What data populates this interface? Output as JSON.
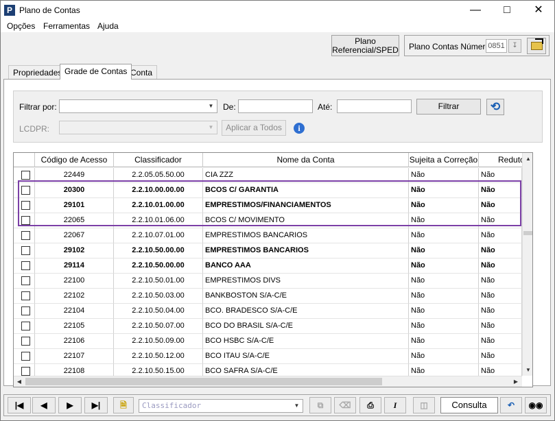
{
  "window": {
    "title": "Plano de Contas",
    "app_icon": "P",
    "minimize_icon": "minimize-icon",
    "maximize_icon": "maximize-icon",
    "close_icon": "close-icon"
  },
  "menu": [
    "Opções",
    "Ferramentas",
    "Ajuda"
  ],
  "top_buttons": {
    "plano_line1": "Plano",
    "plano_line2": "Referencial/SPED",
    "pcn_label": "Plano Contas Número",
    "pcn_value": "0851"
  },
  "tabs": [
    "Propriedades",
    "Grade de Contas",
    "Conta"
  ],
  "active_tab": "Grade de Contas",
  "filter": {
    "filtrar_por_label": "Filtrar por:",
    "filtrar_por_value": "",
    "de_label": "De:",
    "de_value": "",
    "ate_label": "Até:",
    "ate_value": "",
    "filtrar_button": "Filtrar",
    "lcdpr_label": "LCDPR:",
    "lcdpr_value": "",
    "aplicar_button": "Aplicar a Todos",
    "info_icon": "i"
  },
  "grid": {
    "columns": [
      "Código de Acesso",
      "Classificador",
      "Nome da Conta",
      "Sujeita a Correção",
      "Redutora"
    ],
    "header_visible": [
      "Código de Acesso",
      "Classificador",
      "Nome da Conta",
      "Sujeita a Correção",
      "Reduto"
    ],
    "rows": [
      {
        "checked": false,
        "bold": false,
        "codigo": "22449",
        "classificador": "2.2.05.05.50.00",
        "nome": "CIA ZZZ",
        "correcao": "Não",
        "redutora": "Não"
      },
      {
        "checked": false,
        "bold": true,
        "codigo": "20300",
        "classificador": "2.2.10.00.00.00",
        "nome": "BCOS C/ GARANTIA",
        "correcao": "Não",
        "redutora": "Não"
      },
      {
        "checked": false,
        "bold": true,
        "codigo": "29101",
        "classificador": "2.2.10.01.00.00",
        "nome": "EMPRESTIMOS/FINANCIAMENTOS",
        "correcao": "Não",
        "redutora": "Não"
      },
      {
        "checked": false,
        "bold": false,
        "codigo": "22065",
        "classificador": "2.2.10.01.06.00",
        "nome": "BCOS C/ MOVIMENTO",
        "correcao": "Não",
        "redutora": "Não"
      },
      {
        "checked": false,
        "bold": false,
        "codigo": "22067",
        "classificador": "2.2.10.07.01.00",
        "nome": "EMPRESTIMOS BANCARIOS",
        "correcao": "Não",
        "redutora": "Não"
      },
      {
        "checked": false,
        "bold": true,
        "codigo": "29102",
        "classificador": "2.2.10.50.00.00",
        "nome": "EMPRESTIMOS BANCARIOS",
        "correcao": "Não",
        "redutora": "Não"
      },
      {
        "checked": false,
        "bold": true,
        "codigo": "29114",
        "classificador": "2.2.10.50.00.00",
        "nome": "BANCO AAA",
        "correcao": "Não",
        "redutora": "Não"
      },
      {
        "checked": false,
        "bold": false,
        "codigo": "22100",
        "classificador": "2.2.10.50.01.00",
        "nome": "EMPRESTIMOS DIVS",
        "correcao": "Não",
        "redutora": "Não"
      },
      {
        "checked": false,
        "bold": false,
        "codigo": "22102",
        "classificador": "2.2.10.50.03.00",
        "nome": "BANKBOSTON S/A-C/E",
        "correcao": "Não",
        "redutora": "Não"
      },
      {
        "checked": false,
        "bold": false,
        "codigo": "22104",
        "classificador": "2.2.10.50.04.00",
        "nome": "BCO. BRADESCO S/A-C/E",
        "correcao": "Não",
        "redutora": "Não"
      },
      {
        "checked": false,
        "bold": false,
        "codigo": "22105",
        "classificador": "2.2.10.50.07.00",
        "nome": "BCO DO BRASIL S/A-C/E",
        "correcao": "Não",
        "redutora": "Não"
      },
      {
        "checked": false,
        "bold": false,
        "codigo": "22106",
        "classificador": "2.2.10.50.09.00",
        "nome": "BCO HSBC S/A-C/E",
        "correcao": "Não",
        "redutora": "Não"
      },
      {
        "checked": false,
        "bold": false,
        "codigo": "22107",
        "classificador": "2.2.10.50.12.00",
        "nome": "BCO ITAU S/A-C/E",
        "correcao": "Não",
        "redutora": "Não"
      },
      {
        "checked": false,
        "bold": false,
        "codigo": "22108",
        "classificador": "2.2.10.50.15.00",
        "nome": "BCO SAFRA S/A-C/E",
        "correcao": "Não",
        "redutora": "Não"
      }
    ],
    "highlighted_rows": [
      "20300",
      "29101",
      "22065"
    ]
  },
  "toolbar": {
    "first_icon": "first-record-icon",
    "prev_icon": "previous-record-icon",
    "next_icon": "next-record-icon",
    "last_icon": "last-record-icon",
    "new_icon": "new-document-icon",
    "search_placeholder": "Classificador",
    "mode_label": "Consulta"
  },
  "colors": {
    "highlight_border": "#7b3fa6",
    "accent_blue": "#1a5fb4",
    "window_bg": "#f0f0f0"
  }
}
